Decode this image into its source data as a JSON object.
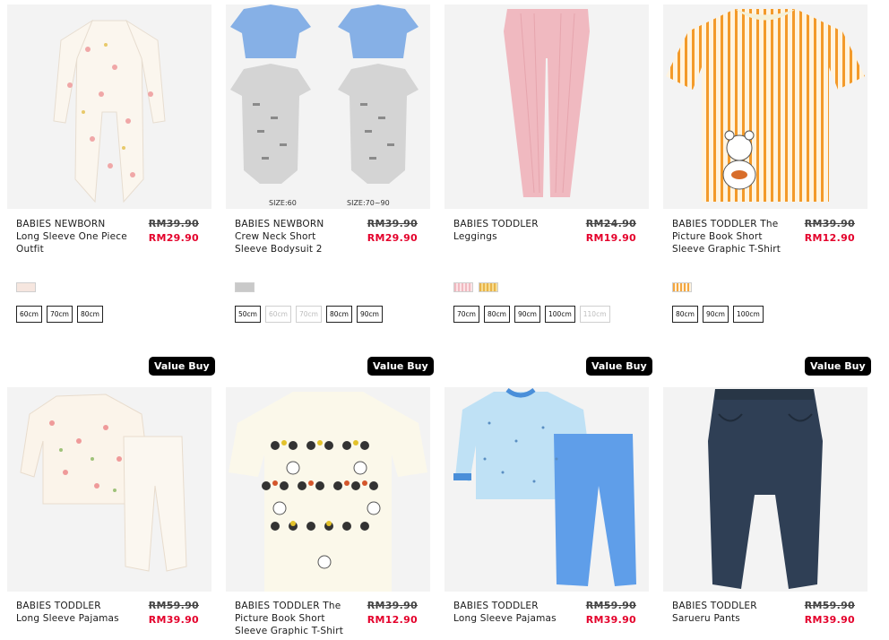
{
  "row1": [
    {
      "name": "BABIES NEWBORN\nLong Sleeve One Piece\nOutfit",
      "old": "RM39.90",
      "new": "RM29.90",
      "sizes": [
        {
          "l": "60cm",
          "on": true
        },
        {
          "l": "70cm",
          "on": true
        },
        {
          "l": "80cm",
          "on": true
        }
      ]
    },
    {
      "name": "BABIES NEWBORN\nCrew Neck Short\nSleeve Bodysuit 2",
      "old": "RM39.90",
      "new": "RM29.90",
      "captions": [
        "SIZE:60",
        "SIZE:70~90"
      ],
      "sizes": [
        {
          "l": "50cm",
          "on": true
        },
        {
          "l": "60cm",
          "on": false
        },
        {
          "l": "70cm",
          "on": false
        },
        {
          "l": "80cm",
          "on": true
        },
        {
          "l": "90cm",
          "on": true
        }
      ]
    },
    {
      "name": "BABIES TODDLER\nLeggings",
      "old": "RM24.90",
      "new": "RM19.90",
      "sizes": [
        {
          "l": "70cm",
          "on": true
        },
        {
          "l": "80cm",
          "on": true
        },
        {
          "l": "90cm",
          "on": true
        },
        {
          "l": "100cm",
          "on": true
        },
        {
          "l": "110cm",
          "on": false
        }
      ]
    },
    {
      "name": "BABIES TODDLER The\nPicture Book Short\nSleeve Graphic T-Shirt",
      "old": "RM39.90",
      "new": "RM12.90",
      "sizes": [
        {
          "l": "80cm",
          "on": true
        },
        {
          "l": "90cm",
          "on": true
        },
        {
          "l": "100cm",
          "on": true
        }
      ]
    }
  ],
  "row2": [
    {
      "badge": "Value Buy",
      "name": "BABIES TODDLER\nLong Sleeve Pajamas",
      "old": "RM59.90",
      "new": "RM39.90"
    },
    {
      "badge": "Value Buy",
      "name": "BABIES TODDLER The\nPicture Book Short\nSleeve Graphic T-Shirt",
      "old": "RM39.90",
      "new": "RM12.90"
    },
    {
      "badge": "Value Buy",
      "name": "BABIES TODDLER\nLong Sleeve Pajamas",
      "old": "RM59.90",
      "new": "RM39.90"
    },
    {
      "badge": "Value Buy",
      "name": "BABIES TODDLER\nSarueru Pants",
      "old": "RM59.90",
      "new": "RM39.90"
    }
  ],
  "colors": {
    "sale": "#e4002b",
    "badge_bg": "#000000",
    "image_bg": "#f1f1f1"
  },
  "swatch_colors": [
    [
      "#f6e6df"
    ],
    [
      "#c9c9c9"
    ],
    [
      "#f0b9c0",
      "#e8b44a"
    ],
    [
      "#f4a640"
    ]
  ]
}
